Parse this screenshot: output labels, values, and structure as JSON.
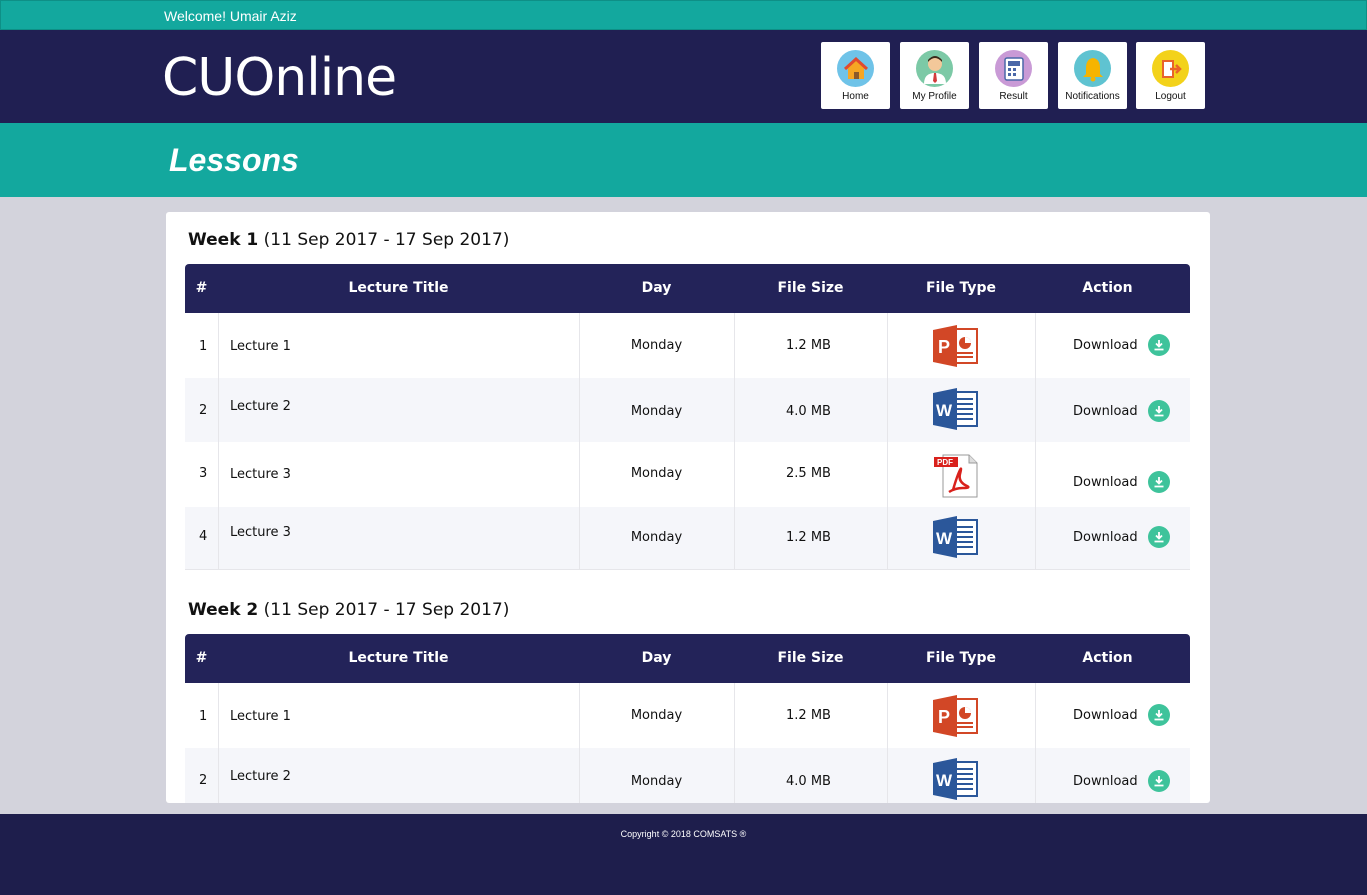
{
  "topbar": {
    "welcome": "Welcome! Umair Aziz"
  },
  "header": {
    "logo_text": "CUOnline",
    "nav": [
      {
        "label": "Home",
        "icon": "home-icon"
      },
      {
        "label": "My Profile",
        "icon": "profile-icon"
      },
      {
        "label": "Result",
        "icon": "result-icon"
      },
      {
        "label": "Notifications",
        "icon": "bell-icon"
      },
      {
        "label": "Logout",
        "icon": "logout-icon"
      }
    ]
  },
  "page": {
    "title": "Lessons"
  },
  "columns": [
    "#",
    "Lecture Title",
    "Day",
    "File Size",
    "File Type",
    "Action"
  ],
  "weeks": [
    {
      "label": "Week 1",
      "range": "(11 Sep 2017 - 17 Sep 2017)",
      "rows": [
        {
          "num": "1",
          "title": "Lecture 1",
          "day": "Monday",
          "size": "1.2 MB",
          "type": "powerpoint",
          "action": "Download"
        },
        {
          "num": "2",
          "title": "Lecture 2",
          "day": "Monday",
          "size": "4.0 MB",
          "type": "word",
          "action": "Download"
        },
        {
          "num": "3",
          "title": "Lecture 3",
          "day": "Monday",
          "size": "2.5 MB",
          "type": "pdf",
          "action": "Download"
        },
        {
          "num": "4",
          "title": "Lecture 3",
          "day": "Monday",
          "size": "1.2 MB",
          "type": "word",
          "action": "Download"
        }
      ]
    },
    {
      "label": "Week 2",
      "range": "(11 Sep 2017 - 17 Sep 2017)",
      "rows": [
        {
          "num": "1",
          "title": "Lecture 1",
          "day": "Monday",
          "size": "1.2 MB",
          "type": "powerpoint",
          "action": "Download"
        },
        {
          "num": "2",
          "title": "Lecture 2",
          "day": "Monday",
          "size": "4.0 MB",
          "type": "word",
          "action": "Download"
        }
      ]
    }
  ],
  "filetype_labels": {
    "powerpoint": "P",
    "word": "W",
    "pdf": "PDF"
  },
  "footer": {
    "copyright": "Copyright © 2018 COMSATS ®"
  },
  "colors": {
    "teal": "#13a89e",
    "navy": "#201f52",
    "download_green": "#3ec39b",
    "ppt_red": "#d24726",
    "word_blue": "#2b579a",
    "pdf_red": "#d9211c"
  }
}
